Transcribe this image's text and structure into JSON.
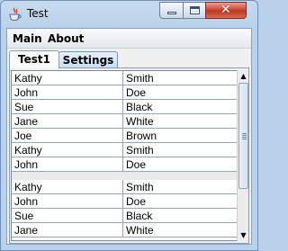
{
  "window": {
    "title": "Test",
    "icon": "java-cup-icon",
    "controls": [
      "minimize-icon",
      "maximize-icon",
      "close-icon"
    ],
    "close_symbol": "✕"
  },
  "menubar": {
    "items": [
      {
        "label": "Main"
      },
      {
        "label": "About"
      }
    ]
  },
  "tabs": [
    {
      "label": "Test1",
      "selected": true
    },
    {
      "label": "Settings",
      "selected": false
    }
  ],
  "table": {
    "groups": [
      {
        "rows": [
          {
            "first": "Kathy",
            "last": "Smith"
          },
          {
            "first": "John",
            "last": "Doe"
          },
          {
            "first": "Sue",
            "last": "Black"
          },
          {
            "first": "Jane",
            "last": "White"
          },
          {
            "first": "Joe",
            "last": "Brown"
          },
          {
            "first": "Kathy",
            "last": "Smith"
          },
          {
            "first": "John",
            "last": "Doe"
          }
        ]
      },
      {
        "rows": [
          {
            "first": "Kathy",
            "last": "Smith"
          },
          {
            "first": "John",
            "last": "Doe"
          },
          {
            "first": "Sue",
            "last": "Black"
          },
          {
            "first": "Jane",
            "last": "White"
          }
        ]
      }
    ]
  },
  "scrollbar": {
    "up_arrow": "▲",
    "down_arrow": "▼"
  }
}
